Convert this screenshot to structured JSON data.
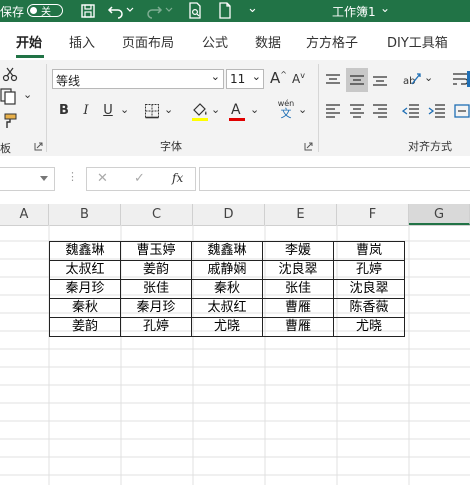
{
  "titlebar": {
    "autosave_label": "保存",
    "toggle_label": "关",
    "doc_title": "工作簿1",
    "title_chevron": "⌄"
  },
  "tabs": [
    {
      "label": "开始"
    },
    {
      "label": "插入"
    },
    {
      "label": "页面布局"
    },
    {
      "label": "公式"
    },
    {
      "label": "数据"
    },
    {
      "label": "方方格子"
    },
    {
      "label": "DIY工具箱"
    }
  ],
  "ribbon": {
    "font_name": "等线",
    "font_size": "11",
    "bold": "B",
    "italic": "I",
    "underline": "U",
    "wen": "wén",
    "wen_char": "文",
    "group_font": "字体",
    "group_align": "对齐方式",
    "group_left_fragment": "板"
  },
  "formula": {
    "fx": "fx",
    "cancel": "✕",
    "enter": "✓"
  },
  "columns": [
    "A",
    "B",
    "C",
    "D",
    "E",
    "F",
    "G"
  ],
  "table": [
    [
      "魏鑫琳",
      "曹玉婷",
      "魏鑫琳",
      "李媛",
      "曹岚"
    ],
    [
      "太叔红",
      "姜韵",
      "戚静娴",
      "沈良翠",
      "孔婷"
    ],
    [
      "秦月珍",
      "张佳",
      "秦秋",
      "张佳",
      "沈良翠"
    ],
    [
      "秦秋",
      "秦月珍",
      "太叔红",
      "曹雁",
      "陈香薇"
    ],
    [
      "姜韵",
      "孔婷",
      "尤晓",
      "曹雁",
      "尤晓"
    ]
  ],
  "colors": {
    "brand": "#217346",
    "font_highlight": "#ffff00",
    "font_color": "#e00000"
  }
}
